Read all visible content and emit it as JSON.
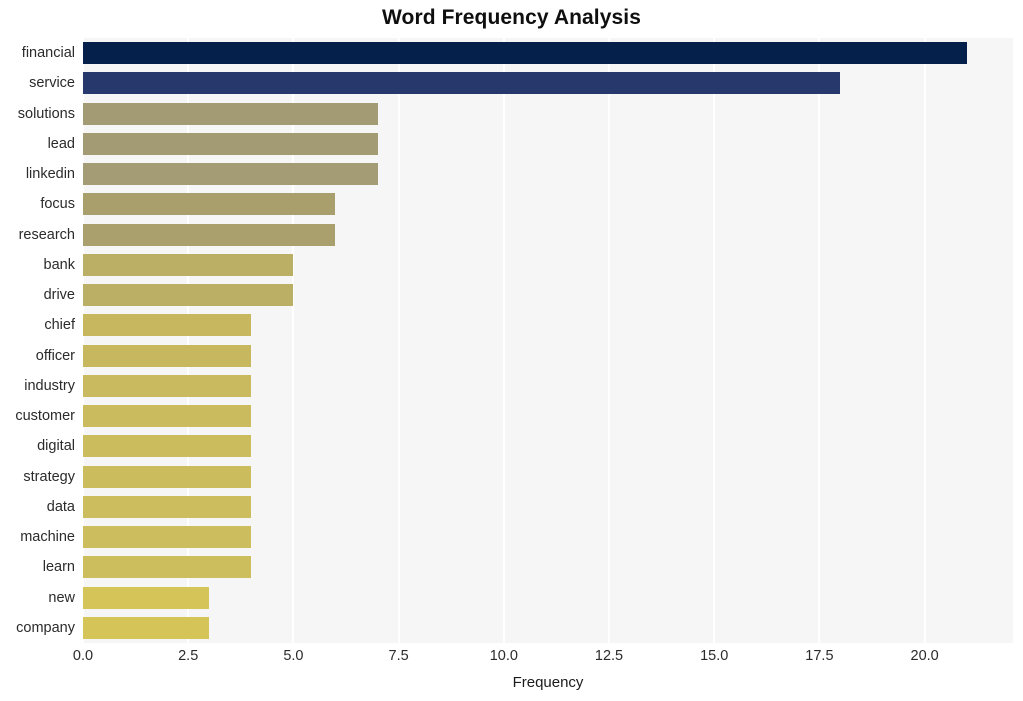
{
  "chart_data": {
    "type": "bar",
    "orientation": "horizontal",
    "title": "Word Frequency Analysis",
    "xlabel": "Frequency",
    "ylabel": "",
    "categories": [
      "financial",
      "service",
      "solutions",
      "lead",
      "linkedin",
      "focus",
      "research",
      "bank",
      "drive",
      "chief",
      "officer",
      "industry",
      "customer",
      "digital",
      "strategy",
      "data",
      "machine",
      "learn",
      "new",
      "company"
    ],
    "values": [
      21,
      18,
      7,
      7,
      7,
      6,
      6,
      5,
      5,
      4,
      4,
      4,
      4,
      4,
      4,
      4,
      4,
      4,
      3,
      3
    ],
    "bar_colors": [
      "#04204b",
      "#27396c",
      "#a39b73",
      "#a39b73",
      "#a39c74",
      "#a99f6d",
      "#aaa06d",
      "#bbae65",
      "#bbae65",
      "#c7b860",
      "#c7b860",
      "#c9ba5f",
      "#cabb5f",
      "#cbbc5e",
      "#cbbc5e",
      "#ccbd5e",
      "#ccbd5e",
      "#cdbe5d",
      "#d5c559",
      "#d5c559"
    ],
    "xlim": [
      0,
      22.1
    ],
    "xticks": [
      0.0,
      2.5,
      5.0,
      7.5,
      10.0,
      12.5,
      15.0,
      17.5,
      20.0
    ],
    "xtick_labels": [
      "0.0",
      "2.5",
      "5.0",
      "7.5",
      "10.0",
      "12.5",
      "15.0",
      "17.5",
      "20.0"
    ],
    "grid": true,
    "grid_axis": "x",
    "legend": null,
    "plot_background": "#f6f6f7",
    "figure_background": "#ffffff",
    "gridline_color": "#ffffff"
  }
}
